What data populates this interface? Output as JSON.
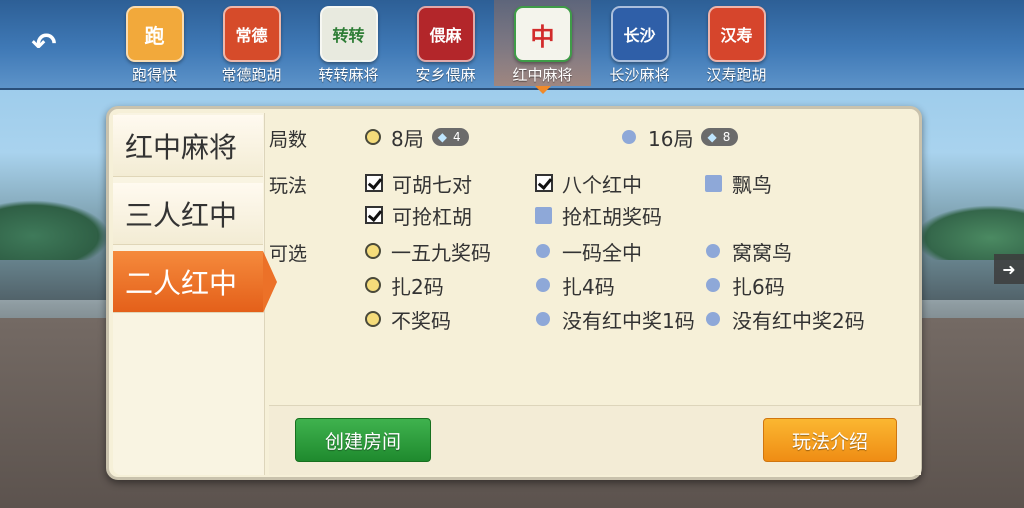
{
  "topbar": {
    "back_icon": "back-arrow-icon",
    "games": [
      {
        "label": "跑得快",
        "icon_text": "跑",
        "color": "#f2a93b"
      },
      {
        "label": "常德跑胡",
        "icon_text": "常德",
        "color": "#d64b2a"
      },
      {
        "label": "转转麻将",
        "icon_text": "转转",
        "color": "#3e9a4a"
      },
      {
        "label": "安乡偎麻",
        "icon_text": "偎麻",
        "color": "#b3262a"
      },
      {
        "label": "红中麻将",
        "icon_text": "中",
        "color": "#3f9c48"
      },
      {
        "label": "长沙麻将",
        "icon_text": "长沙",
        "color": "#2f5fa8"
      },
      {
        "label": "汉寿跑胡",
        "icon_text": "汉寿",
        "color": "#d6452c"
      }
    ],
    "active_index": 4
  },
  "sidebar": {
    "tabs": [
      "红中麻将",
      "三人红中",
      "二人红中"
    ],
    "active_index": 2
  },
  "options": {
    "rounds": {
      "label": "局数",
      "items": [
        {
          "text": "8局",
          "cost": "4",
          "selected": true
        },
        {
          "text": "16局",
          "cost": "8",
          "selected": false
        }
      ]
    },
    "rules": {
      "label": "玩法",
      "items": [
        {
          "text": "可胡七对",
          "checked": true
        },
        {
          "text": "八个红中",
          "checked": true
        },
        {
          "text": "飘鸟",
          "checked": false
        },
        {
          "text": "可抢杠胡",
          "checked": true
        },
        {
          "text": "抢杠胡奖码",
          "checked": false
        }
      ]
    },
    "optional": {
      "label": "可选",
      "items": [
        {
          "text": "一五九奖码",
          "selected": true
        },
        {
          "text": "一码全中",
          "selected": false
        },
        {
          "text": "窝窝鸟",
          "selected": false
        },
        {
          "text": "扎2码",
          "selected": true
        },
        {
          "text": "扎4码",
          "selected": false
        },
        {
          "text": "扎6码",
          "selected": false
        },
        {
          "text": "不奖码",
          "selected": true
        },
        {
          "text": "没有红中奖1码",
          "selected": false
        },
        {
          "text": "没有红中奖2码",
          "selected": false
        }
      ]
    }
  },
  "footer": {
    "create_label": "创建房间",
    "rules_label": "玩法介绍"
  },
  "side_arrow_icon": "arrow-right-icon",
  "colors": {
    "accent_orange": "#ec7128",
    "create_green": "#2ea03c",
    "panel_bg": "#f6f0d8"
  }
}
